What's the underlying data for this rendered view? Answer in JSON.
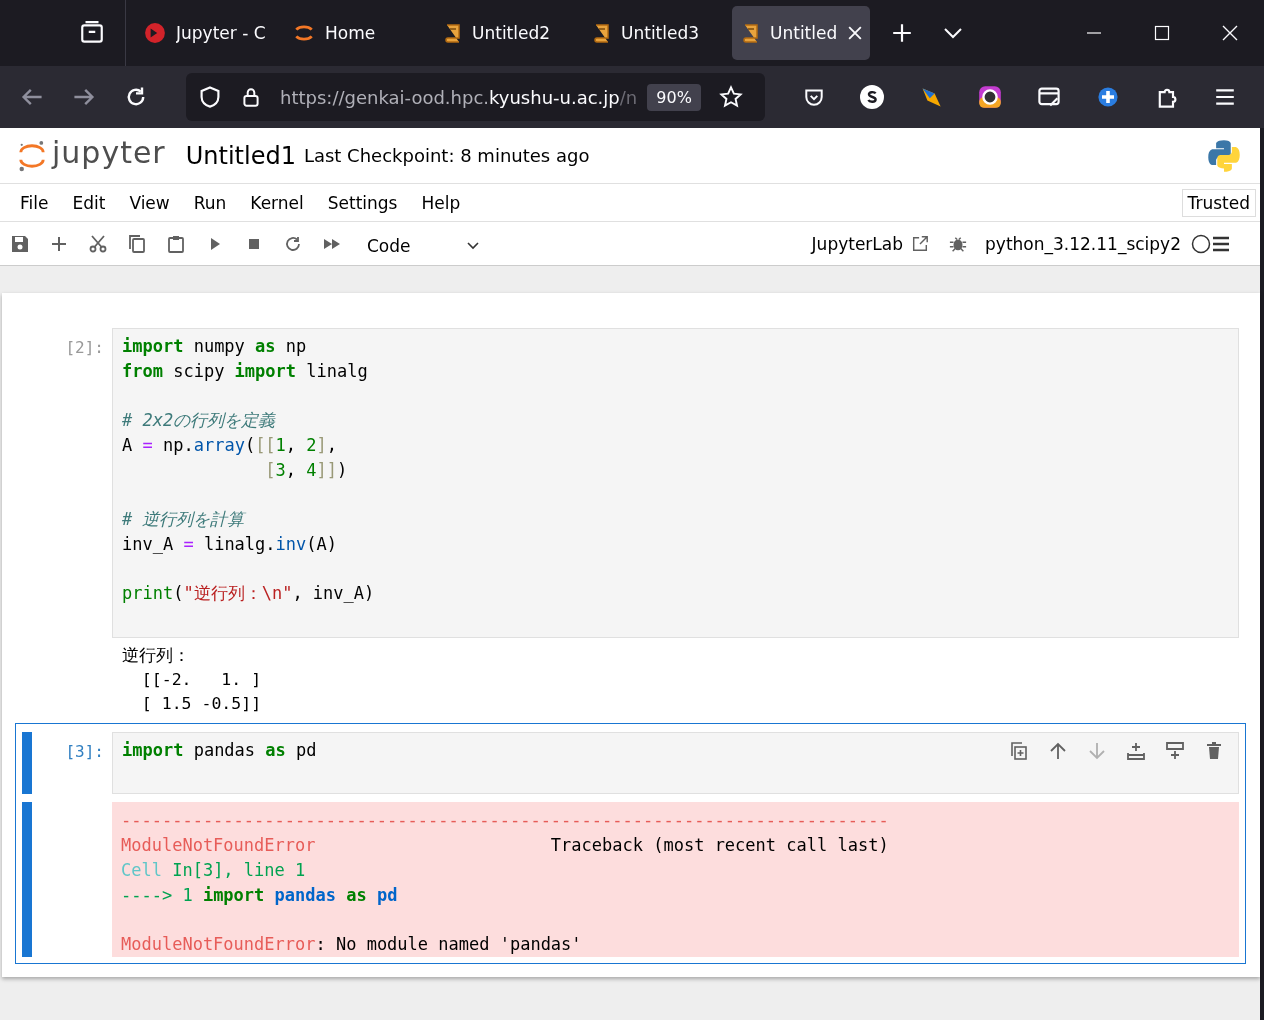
{
  "browser": {
    "tabs": [
      {
        "label": "Jupyter - C",
        "kind": "jupyter",
        "selected": false
      },
      {
        "label": "Home",
        "kind": "home",
        "selected": false
      },
      {
        "label": "Untitled2",
        "kind": "notebook",
        "selected": false
      },
      {
        "label": "Untitled3",
        "kind": "notebook",
        "selected": false
      },
      {
        "label": "Untitled",
        "kind": "notebook",
        "selected": true
      }
    ],
    "url": {
      "prefix": "https://genkai-ood.hpc.",
      "domain": "kyushu-u.ac.jp",
      "suffix": "/n"
    },
    "zoom": "90%"
  },
  "header": {
    "logo_text": "jupyter",
    "title": "Untitled1",
    "checkpoint": "Last Checkpoint: 8 minutes ago"
  },
  "menu": [
    "File",
    "Edit",
    "View",
    "Run",
    "Kernel",
    "Settings",
    "Help"
  ],
  "trusted": "Trusted",
  "toolbar": {
    "cell_type": "Code",
    "lab_link": "JupyterLab",
    "kernel": {
      "name": "python_3.12.11_scipy2",
      "busy": false
    }
  },
  "cells": [
    {
      "prompt": "[2]:",
      "selected": false,
      "code_blocks": [
        [
          [
            {
              "kind": "kw",
              "text": "import"
            },
            {
              "kind": "plain",
              "text": " numpy "
            },
            {
              "kind": "kw",
              "text": "as"
            },
            {
              "kind": "plain",
              "text": " np"
            }
          ],
          [
            {
              "kind": "kw",
              "text": "from"
            },
            {
              "kind": "plain",
              "text": " scipy "
            },
            {
              "kind": "kw",
              "text": "import"
            },
            {
              "kind": "plain",
              "text": " linalg"
            }
          ]
        ],
        [
          [
            {
              "kind": "comment",
              "text": "# 2x2の行列を定義"
            }
          ],
          [
            {
              "kind": "plain",
              "text": "A "
            },
            {
              "kind": "op",
              "text": "="
            },
            {
              "kind": "plain",
              "text": " np."
            },
            {
              "kind": "fn",
              "text": "array"
            },
            {
              "kind": "plain",
              "text": "("
            },
            {
              "kind": "bracket",
              "text": "[["
            },
            {
              "kind": "num",
              "text": "1"
            },
            {
              "kind": "plain",
              "text": ", "
            },
            {
              "kind": "num",
              "text": "2"
            },
            {
              "kind": "bracket",
              "text": "]"
            },
            {
              "kind": "plain",
              "text": ","
            }
          ],
          [
            {
              "kind": "bracket",
              "text": "              ["
            },
            {
              "kind": "num",
              "text": "3"
            },
            {
              "kind": "plain",
              "text": ", "
            },
            {
              "kind": "num",
              "text": "4"
            },
            {
              "kind": "bracket",
              "text": "]]"
            },
            {
              "kind": "plain",
              "text": ")"
            }
          ]
        ],
        [
          [
            {
              "kind": "comment",
              "text": "# 逆行列を計算"
            }
          ],
          [
            {
              "kind": "plain",
              "text": "inv_A "
            },
            {
              "kind": "op",
              "text": "="
            },
            {
              "kind": "plain",
              "text": " linalg."
            },
            {
              "kind": "fn",
              "text": "inv"
            },
            {
              "kind": "plain",
              "text": "(A)"
            }
          ]
        ],
        [
          [
            {
              "kind": "builtin",
              "text": "print"
            },
            {
              "kind": "plain",
              "text": "("
            },
            {
              "kind": "str",
              "text": "\"逆行列：\\n\""
            },
            {
              "kind": "plain",
              "text": ", inv_A)"
            }
          ]
        ]
      ],
      "output": {
        "kind": "stream",
        "lines": [
          "逆行列：",
          "  [[-2.   1. ]",
          "  [ 1.5 -0.5]]"
        ]
      }
    },
    {
      "prompt": "[3]:",
      "selected": true,
      "code_blocks": [
        [
          [
            {
              "kind": "kw",
              "text": "import"
            },
            {
              "kind": "plain",
              "text": " pandas "
            },
            {
              "kind": "kw",
              "text": "as"
            },
            {
              "kind": "plain",
              "text": " pd"
            }
          ]
        ]
      ],
      "output": {
        "kind": "error",
        "blocks": [
          [
            [
              {
                "kind": "red",
                "text": "---------------------------------------------------------------------------"
              }
            ],
            [
              {
                "kind": "red",
                "text": "ModuleNotFoundError"
              },
              {
                "kind": "plain",
                "text": "                       Traceback (most recent call last)"
              }
            ],
            [
              {
                "kind": "cyan",
                "text": "Cell "
              },
              {
                "kind": "green",
                "text": "In[3], line 1"
              }
            ],
            [
              {
                "kind": "green",
                "text": "----> 1 "
              },
              {
                "kind": "greenbold",
                "text": "import"
              },
              {
                "kind": "bluebold",
                "text": " pandas "
              },
              {
                "kind": "greenbold",
                "text": "as"
              },
              {
                "kind": "bluebold",
                "text": " pd"
              }
            ]
          ],
          [
            [
              {
                "kind": "red",
                "text": "ModuleNotFoundError"
              },
              {
                "kind": "plain",
                "text": ": No module named 'pandas'"
              }
            ]
          ]
        ]
      }
    }
  ]
}
